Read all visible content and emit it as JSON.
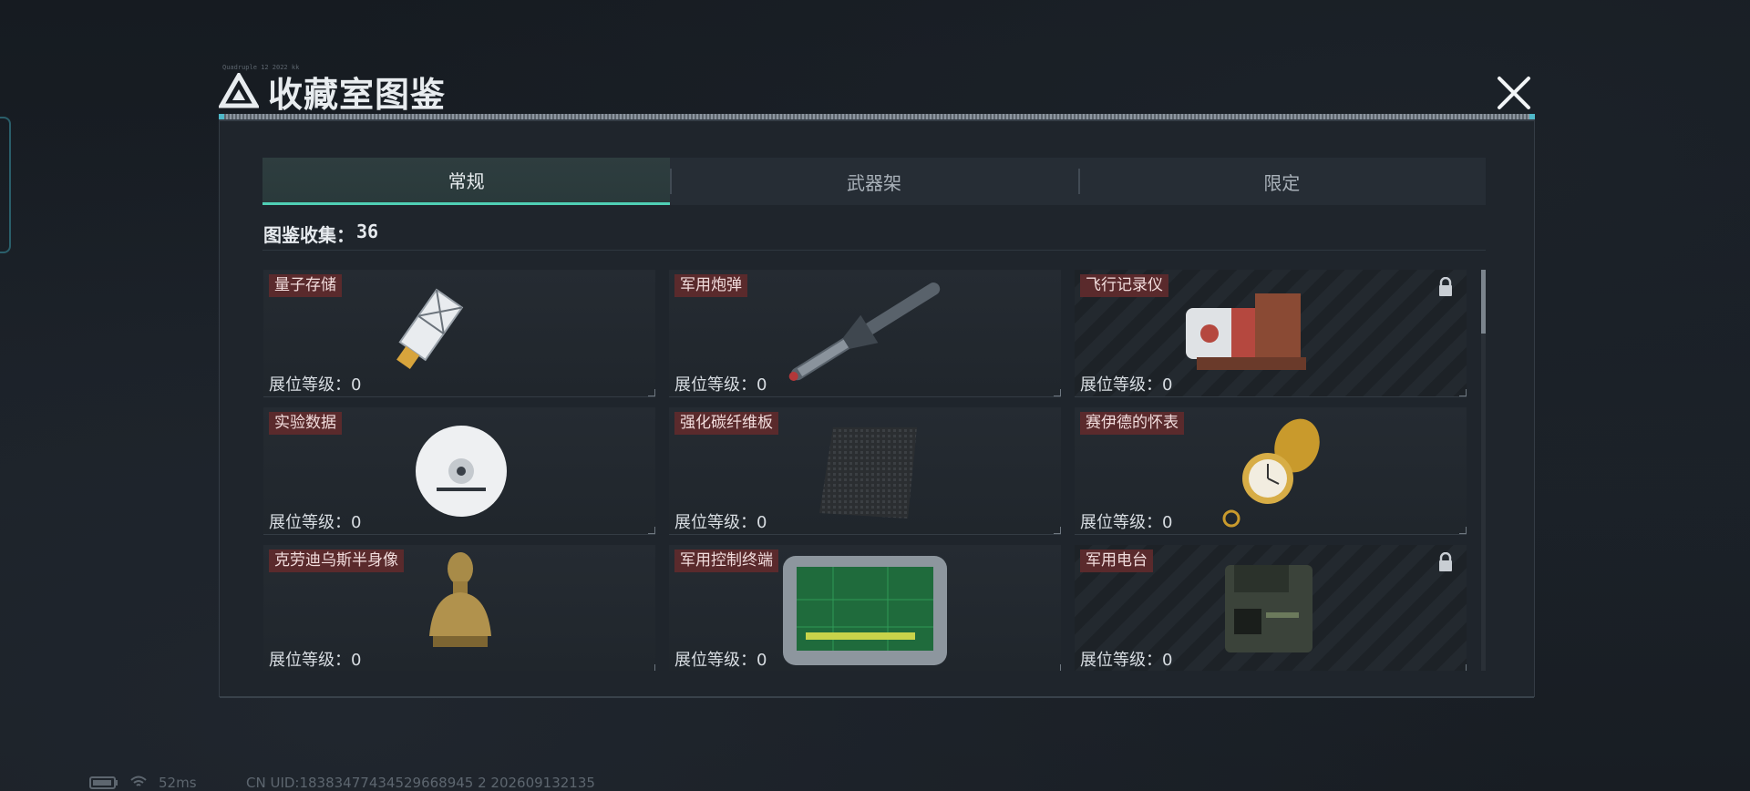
{
  "window": {
    "title": "收藏室图鉴",
    "title_small": "Quadruple 12 2022 kk"
  },
  "tabs": [
    {
      "label": "常规",
      "active": true
    },
    {
      "label": "武器架",
      "active": false
    },
    {
      "label": "限定",
      "active": false
    }
  ],
  "collection": {
    "label": "图鉴收集：",
    "count": "36"
  },
  "items": [
    {
      "name": "量子存储",
      "level": "展位等级：0",
      "locked": false,
      "icon": "usb-drive"
    },
    {
      "name": "军用炮弹",
      "level": "展位等级：0",
      "locked": false,
      "icon": "artillery-shell"
    },
    {
      "name": "飞行记录仪",
      "level": "展位等级：0",
      "locked": true,
      "icon": "flight-recorder"
    },
    {
      "name": "实验数据",
      "level": "展位等级：0",
      "locked": false,
      "icon": "data-disc"
    },
    {
      "name": "强化碳纤维板",
      "level": "展位等级：0",
      "locked": false,
      "icon": "carbon-plate"
    },
    {
      "name": "赛伊德的怀表",
      "level": "展位等级：0",
      "locked": false,
      "icon": "pocket-watch"
    },
    {
      "name": "克劳迪乌斯半身像",
      "level": "展位等级：0",
      "locked": false,
      "icon": "bust"
    },
    {
      "name": "军用控制终端",
      "level": "展位等级：0",
      "locked": false,
      "icon": "control-terminal"
    },
    {
      "name": "军用电台",
      "level": "展位等级：0",
      "locked": true,
      "icon": "radio"
    }
  ],
  "status": {
    "ping": "52ms",
    "uid": "CN UID:18383477434529668945 2 202609132135"
  },
  "colors": {
    "accent": "#4fcfb5",
    "label_bg": "#5a2a2c",
    "panel_bg": "#1f252c"
  }
}
